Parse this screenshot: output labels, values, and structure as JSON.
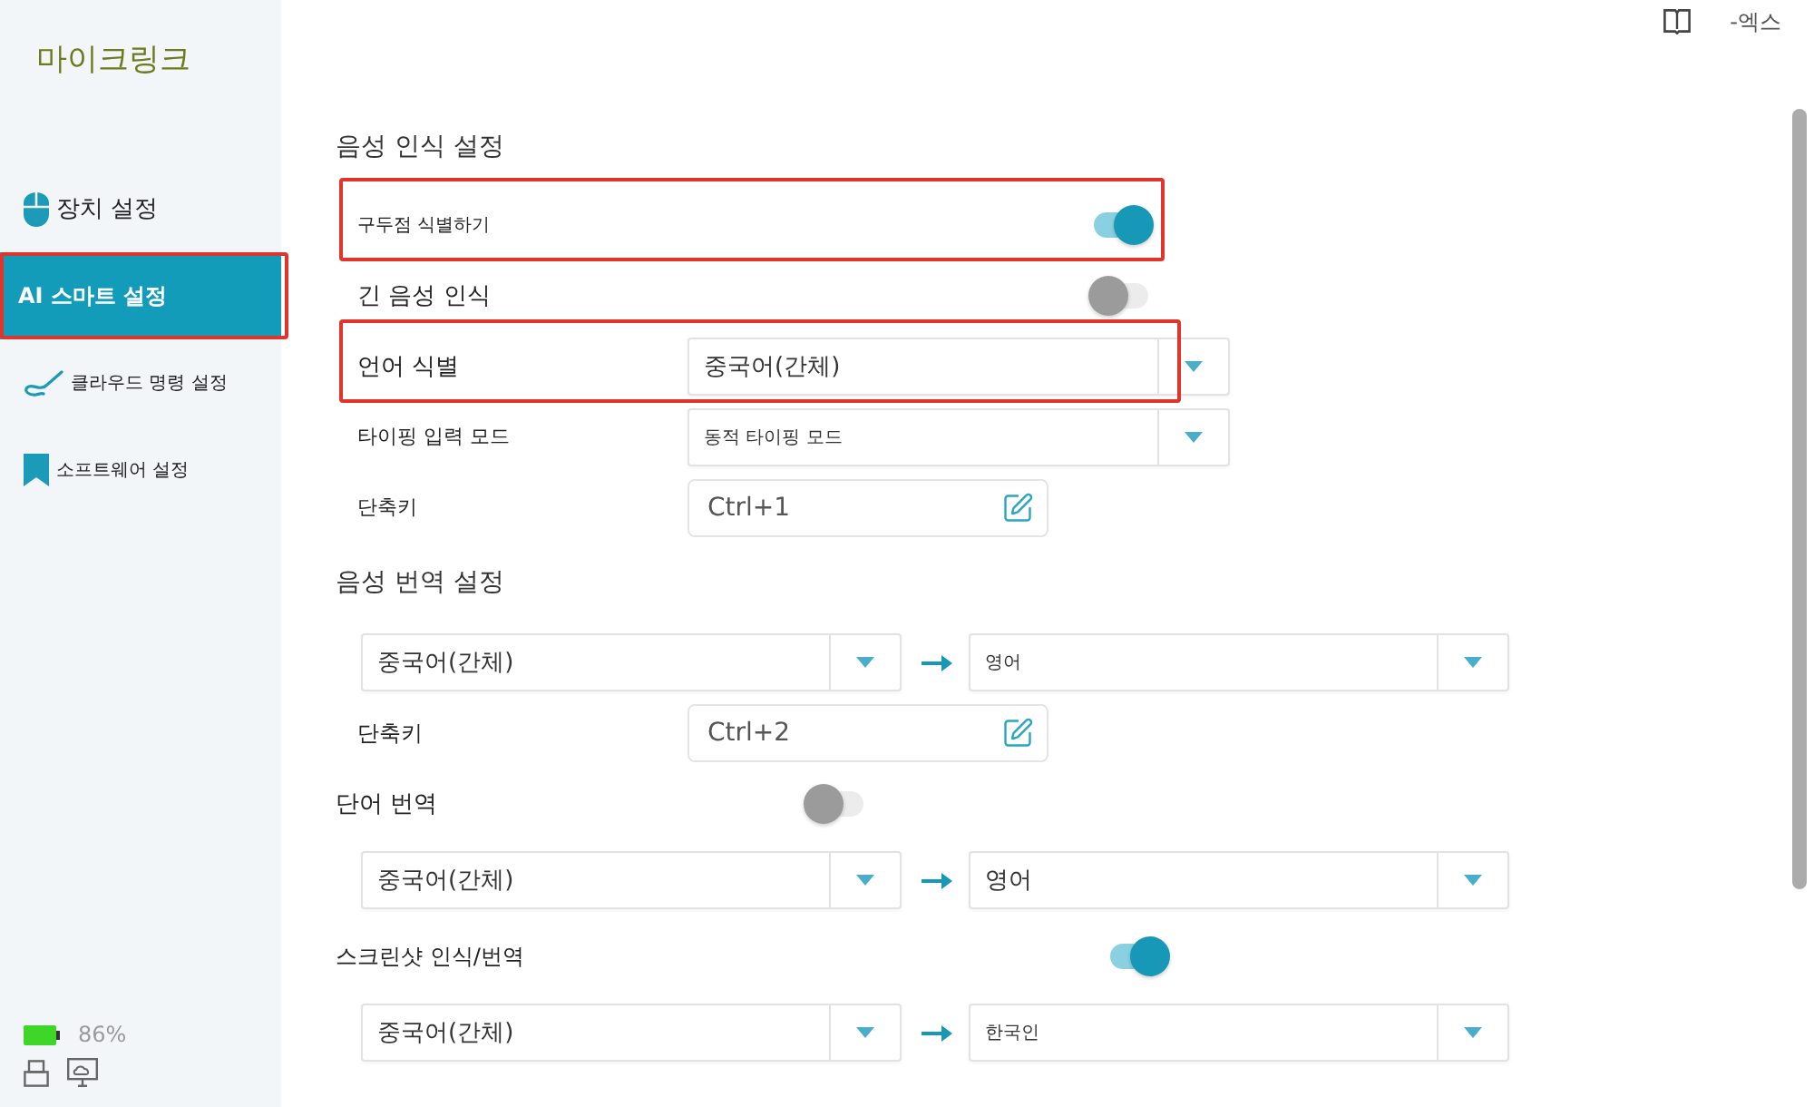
{
  "window_controls": {
    "label": "-엑스"
  },
  "sidebar": {
    "logo": "마이크링크",
    "items": [
      {
        "label": "장치 설정",
        "selected": false,
        "highlighted": false
      },
      {
        "label": "AI 스마트 설정",
        "selected": true,
        "highlighted": true
      },
      {
        "label": "클라우드 명령 설정",
        "selected": false,
        "highlighted": false
      },
      {
        "label": "소프트웨어 설정",
        "selected": false,
        "highlighted": false
      }
    ],
    "battery_text": "86%"
  },
  "speech_recognition": {
    "title": "음성 인식 설정",
    "rows": [
      {
        "kind": "toggle",
        "label": "구두점 식별하기",
        "on": true,
        "highlighted": true
      },
      {
        "kind": "toggle",
        "label": "긴 음성 인식",
        "on": false,
        "highlighted": false
      },
      {
        "kind": "select",
        "label": "언어 식별",
        "value": "중국어(간체)",
        "highlighted": true
      },
      {
        "kind": "select",
        "label": "타이핑 입력 모드",
        "value": "동적 타이핑 모드",
        "highlighted": false
      },
      {
        "kind": "hotkey",
        "label": "단축키",
        "value": "Ctrl+1",
        "highlighted": false
      }
    ]
  },
  "speech_translation": {
    "title": "음성 번역 설정",
    "rows": [
      {
        "kind": "pair",
        "source": "중국어(간체)",
        "target": "영어"
      },
      {
        "kind": "hotkey",
        "label": "단축키",
        "value": "Ctrl+2"
      },
      {
        "kind": "toggle",
        "label": "단어 번역",
        "on": false
      },
      {
        "kind": "pair",
        "source": "중국어(간체)",
        "target": "영어"
      },
      {
        "kind": "toggle",
        "label": "스크린샷 인식/번역",
        "on": true
      },
      {
        "kind": "pair",
        "source": "중국어(간체)",
        "target": "한국인"
      }
    ]
  }
}
